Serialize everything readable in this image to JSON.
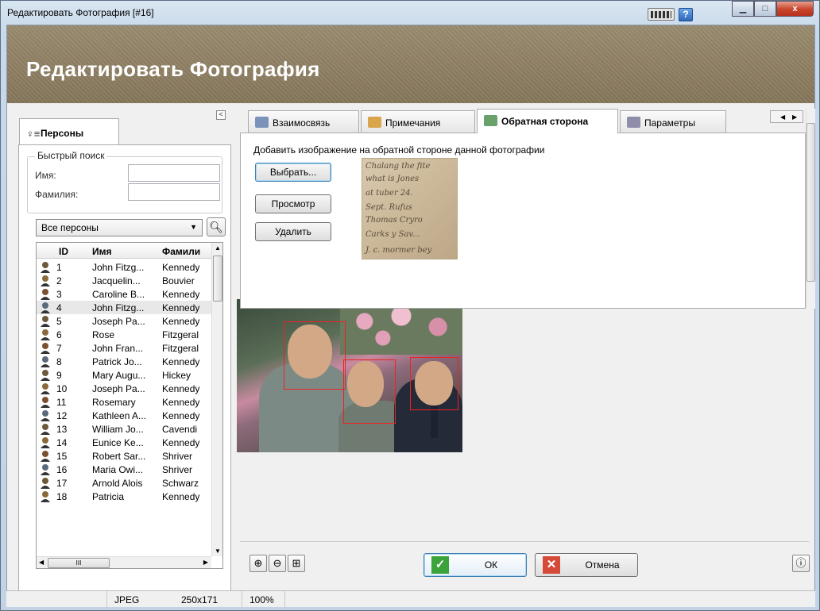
{
  "window": {
    "title": "Редактировать Фотография [#16]",
    "minimize": "▁",
    "maximize": "□",
    "close": "x",
    "help": "?"
  },
  "banner": {
    "heading": "Редактировать Фотография"
  },
  "persons_panel": {
    "tab_label": "Персоны",
    "collapse": "<",
    "quick_search": {
      "title": "Быстрый поиск",
      "name_label": "Имя:",
      "surname_label": "Фамилия:",
      "name_value": "",
      "surname_value": ""
    },
    "filter": {
      "selected": "Все персоны"
    },
    "columns": [
      "ID",
      "Имя",
      "Фамили"
    ],
    "rows": [
      {
        "id": "1",
        "name": "John Fitzg...",
        "surname": "Kennedy"
      },
      {
        "id": "2",
        "name": "Jacquelin...",
        "surname": "Bouvier"
      },
      {
        "id": "3",
        "name": "Caroline B...",
        "surname": "Kennedy"
      },
      {
        "id": "4",
        "name": "John Fitzg...",
        "surname": "Kennedy"
      },
      {
        "id": "5",
        "name": "Joseph Pa...",
        "surname": "Kennedy"
      },
      {
        "id": "6",
        "name": "Rose",
        "surname": "Fitzgeral"
      },
      {
        "id": "7",
        "name": "John Fran...",
        "surname": "Fitzgeral"
      },
      {
        "id": "8",
        "name": "Patrick Jo...",
        "surname": "Kennedy"
      },
      {
        "id": "9",
        "name": "Mary Augu...",
        "surname": "Hickey"
      },
      {
        "id": "10",
        "name": "Joseph Pa...",
        "surname": "Kennedy"
      },
      {
        "id": "11",
        "name": "Rosemary",
        "surname": "Kennedy"
      },
      {
        "id": "12",
        "name": "Kathleen A...",
        "surname": "Kennedy"
      },
      {
        "id": "13",
        "name": "William Jo...",
        "surname": "Cavendi"
      },
      {
        "id": "14",
        "name": "Eunice Ke...",
        "surname": "Kennedy"
      },
      {
        "id": "15",
        "name": "Robert Sar...",
        "surname": "Shriver"
      },
      {
        "id": "16",
        "name": "Maria Owi...",
        "surname": "Shriver"
      },
      {
        "id": "17",
        "name": "Arnold Alois",
        "surname": "Schwarz"
      },
      {
        "id": "18",
        "name": "Patricia",
        "surname": "Kennedy"
      }
    ],
    "hscroll_thumb": "III"
  },
  "tabs": [
    {
      "label": "Взаимосвязь"
    },
    {
      "label": "Примечания"
    },
    {
      "label": "Обратная сторона"
    },
    {
      "label": "Параметры"
    }
  ],
  "back_side": {
    "description": "Добавить изображение на обратной стороне данной фотографии",
    "choose_button": "Выбрать...",
    "view_button": "Просмотр",
    "delete_button": "Удалить",
    "handwriting": [
      "Chalang the fite",
      "what is Jones",
      "at  tuber 24.",
      "Sept. Rufus",
      "Thomas Cryro",
      "Carks y Sav...",
      "J.  c. mormer  bey"
    ]
  },
  "bottom": {
    "ok": "ОК",
    "cancel": "Отмена"
  },
  "status": {
    "format": "JPEG",
    "size": "250x171",
    "zoom": "100%"
  },
  "colors": {
    "banner": "#8a7b5e",
    "face_box": "#e22222",
    "ok_icon": "#3aa33a",
    "cancel_icon": "#d64a3a"
  }
}
